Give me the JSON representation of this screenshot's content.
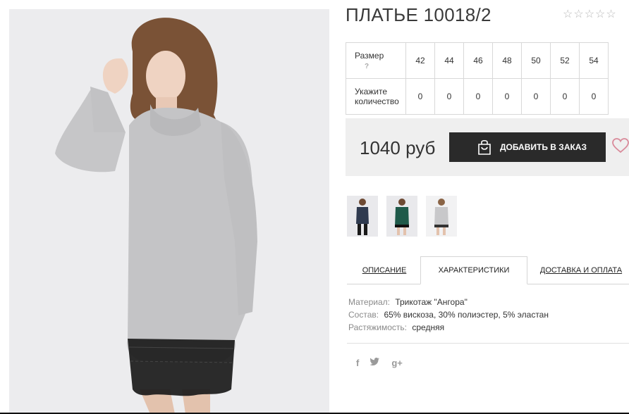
{
  "product": {
    "title": "ПЛАТЬЕ 10018/2",
    "rating_stars": 5
  },
  "sizes_table": {
    "size_label": "Размер",
    "size_hint": "?",
    "qty_label": "Укажите количество",
    "sizes": [
      "42",
      "44",
      "46",
      "48",
      "50",
      "52",
      "54"
    ],
    "quantities": [
      "0",
      "0",
      "0",
      "0",
      "0",
      "0",
      "0"
    ]
  },
  "buy": {
    "price": "1040 руб",
    "order_button": "ДОБАВИТЬ В ЗАКАЗ"
  },
  "thumbnails": [
    {
      "name": "navy-dress"
    },
    {
      "name": "green-dress"
    },
    {
      "name": "grey-dress"
    }
  ],
  "tabs": {
    "description": "ОПИСАНИЕ",
    "characteristics": "ХАРАКТЕРИСТИКИ",
    "delivery": "ДОСТАВКА И ОПЛАТА"
  },
  "characteristics": [
    {
      "label": "Материал:",
      "value": "Трикотаж \"Ангора\""
    },
    {
      "label": "Состав:",
      "value": "65% вискоза, 30% полиэстер, 5% эластан"
    },
    {
      "label": "Растяжимость:",
      "value": "средняя"
    }
  ],
  "social": {
    "facebook": "f",
    "twitter": "twitter-icon",
    "google": "g+"
  },
  "colors": {
    "button_bg": "#2a2a2a",
    "panel_bg": "#efefef",
    "heart": "#d98a9a",
    "dress_grey": "#c4c4c6",
    "lace": "#1a1a1a"
  }
}
